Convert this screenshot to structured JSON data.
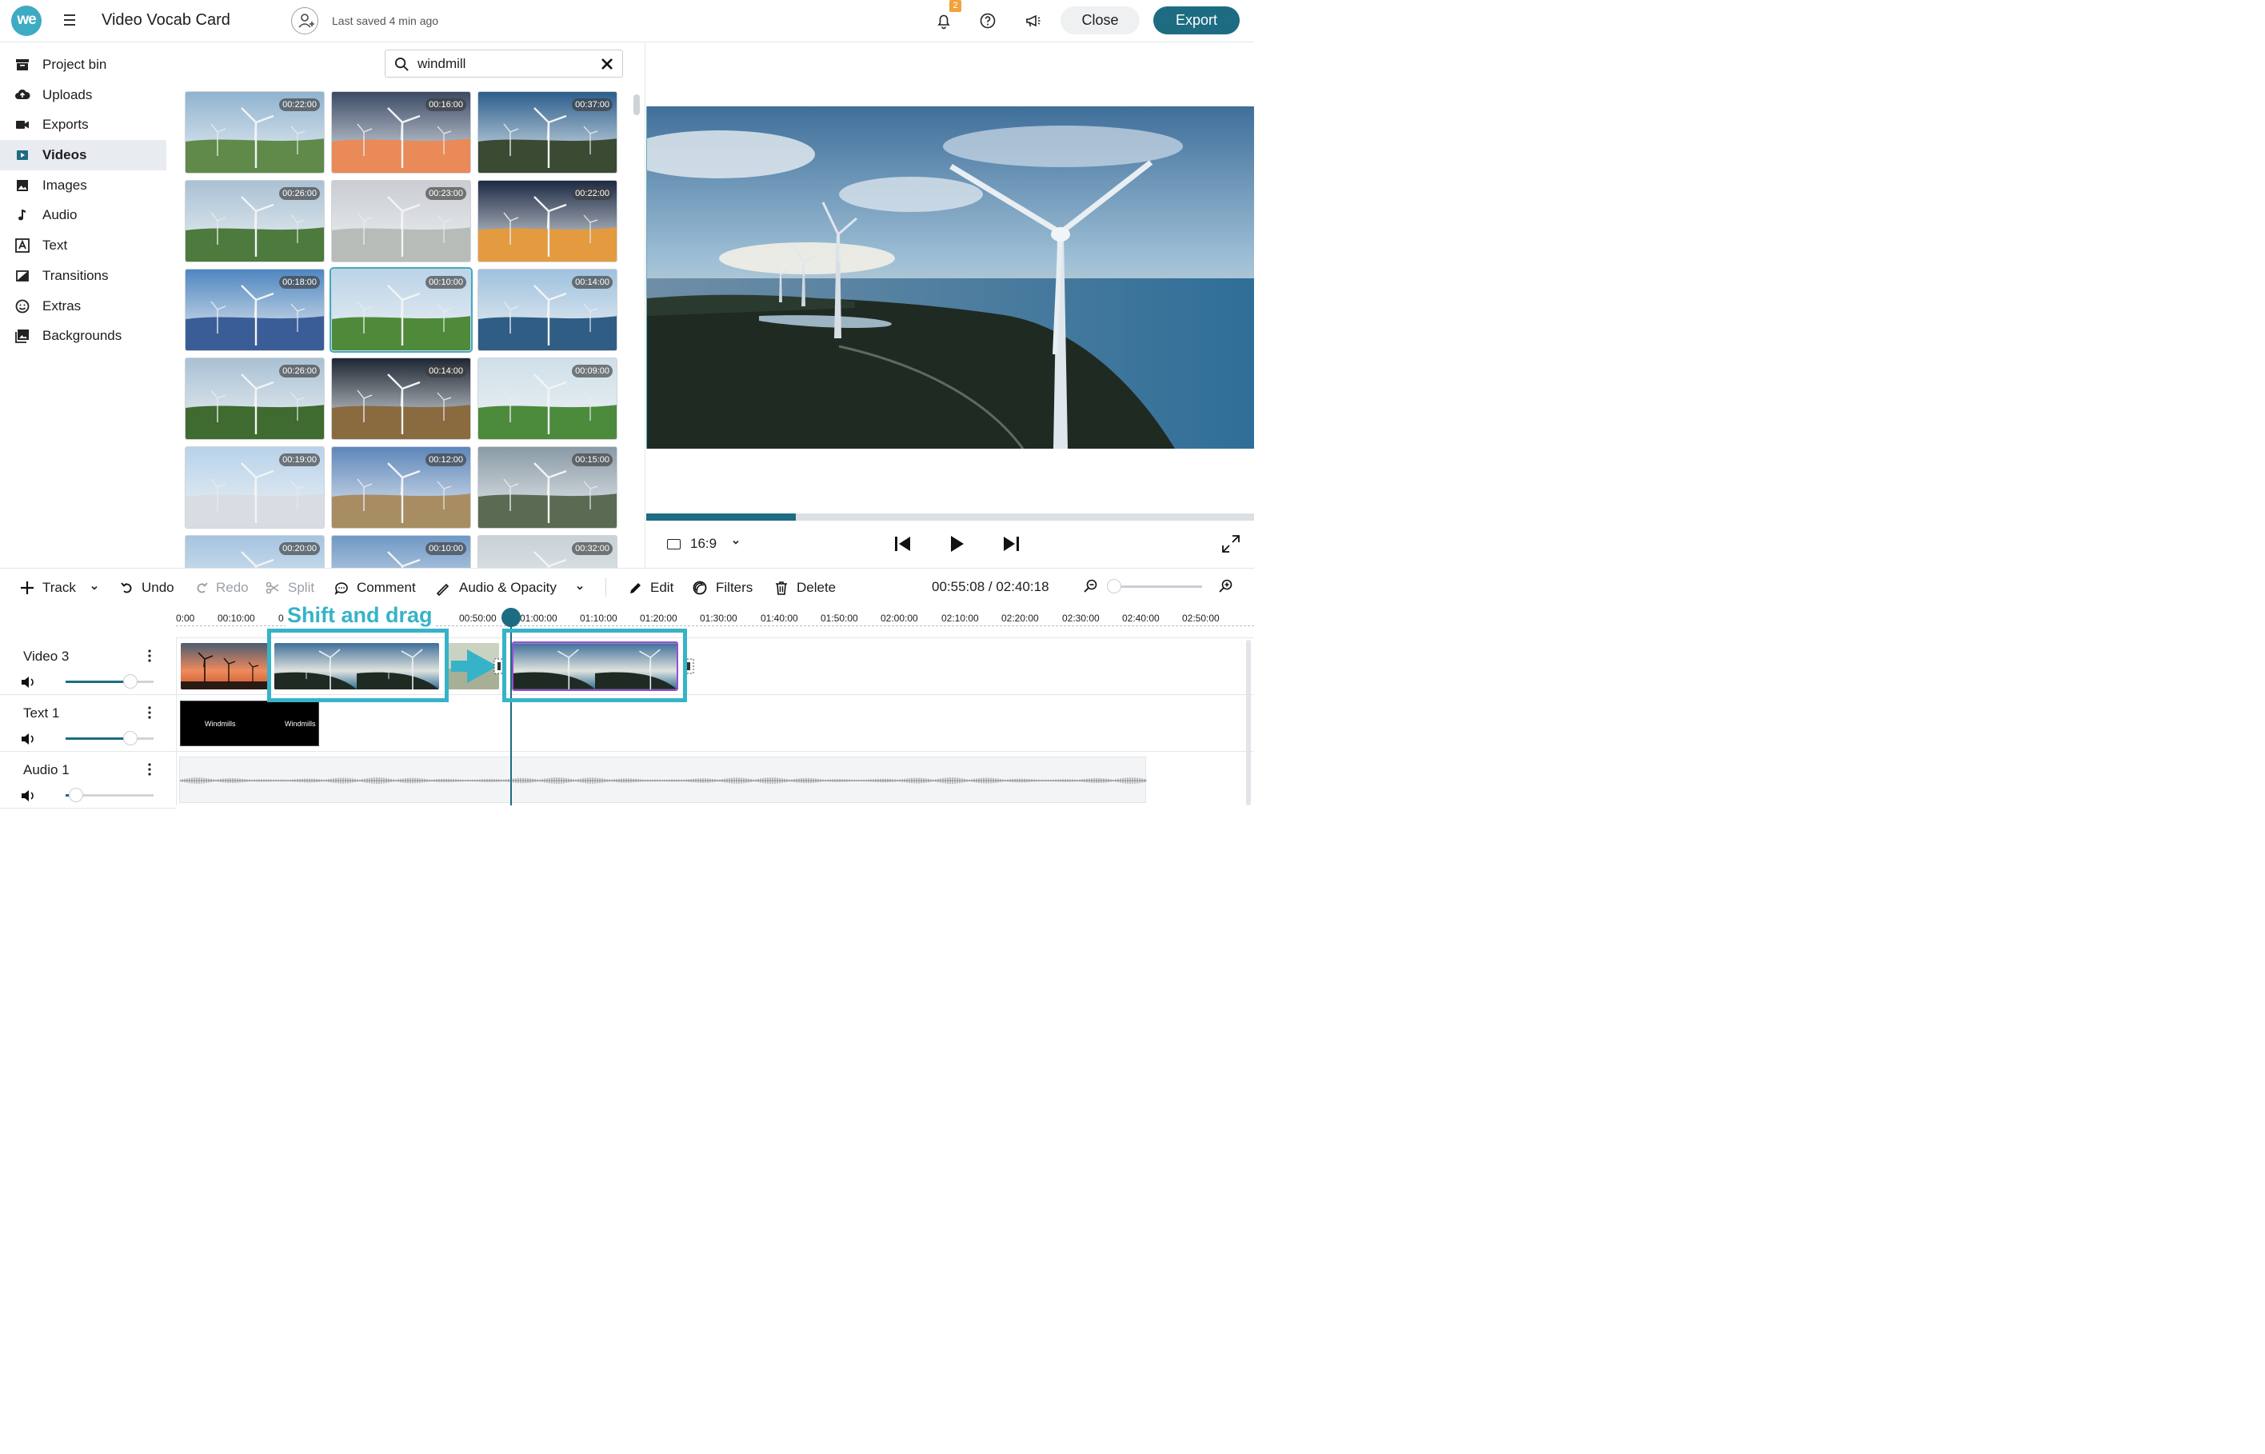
{
  "header": {
    "logo_text": "we",
    "project_title": "Video Vocab Card",
    "last_saved": "Last saved 4 min ago",
    "notifications_count": "2",
    "close_label": "Close",
    "export_label": "Export",
    "accent_color": "#1d6c82",
    "brand_color": "#3dabc4"
  },
  "sidebar": {
    "items": [
      {
        "label": "Project bin",
        "icon": "archive-icon"
      },
      {
        "label": "Uploads",
        "icon": "cloud-upload-icon"
      },
      {
        "label": "Exports",
        "icon": "camera-icon"
      },
      {
        "label": "Videos",
        "icon": "video-icon",
        "active": true
      },
      {
        "label": "Images",
        "icon": "image-icon"
      },
      {
        "label": "Audio",
        "icon": "music-note-icon"
      },
      {
        "label": "Text",
        "icon": "text-icon"
      },
      {
        "label": "Transitions",
        "icon": "transition-icon"
      },
      {
        "label": "Extras",
        "icon": "smiley-icon"
      },
      {
        "label": "Backgrounds",
        "icon": "backgrounds-icon"
      }
    ]
  },
  "search": {
    "value": "windmill"
  },
  "results": {
    "durations": [
      "00:22:00",
      "00:16:00",
      "00:37:00",
      "00:26:00",
      "00:23:00",
      "00:22:00",
      "00:18:00",
      "00:10:00",
      "00:14:00",
      "00:26:00",
      "00:14:00",
      "00:09:00",
      "00:19:00",
      "00:12:00",
      "00:15:00",
      "00:20:00",
      "00:10:00",
      "00:32:00"
    ],
    "selected_index": 7
  },
  "preview": {
    "aspect_ratio": "16:9",
    "progress_fraction": 0.246
  },
  "toolbar": {
    "track": "Track",
    "undo": "Undo",
    "redo": "Redo",
    "split": "Split",
    "comment": "Comment",
    "audio_opacity": "Audio & Opacity",
    "edit": "Edit",
    "filters": "Filters",
    "delete": "Delete",
    "timecode": "00:55:08 / 02:40:18"
  },
  "ruler": {
    "ticks": [
      "0:00",
      "00:10:00",
      "0",
      "0",
      "00:50:00",
      "01:00:00",
      "01:10:00",
      "01:20:00",
      "01:30:00",
      "01:40:00",
      "01:50:00",
      "02:00:00",
      "02:10:00",
      "02:20:00",
      "02:30:00",
      "02:40:00",
      "02:50:00"
    ]
  },
  "tracks": [
    {
      "name": "Video 3",
      "volume_fraction": 0.74
    },
    {
      "name": "Text 1",
      "volume_fraction": 0.74
    },
    {
      "name": "Audio 1",
      "volume_fraction": 0.12
    }
  ],
  "text_clip": {
    "label_left": "Windmills",
    "label_right": "Windmills"
  },
  "annotation": {
    "instruction": "Shift and drag",
    "highlight_color": "#36b3c8"
  }
}
